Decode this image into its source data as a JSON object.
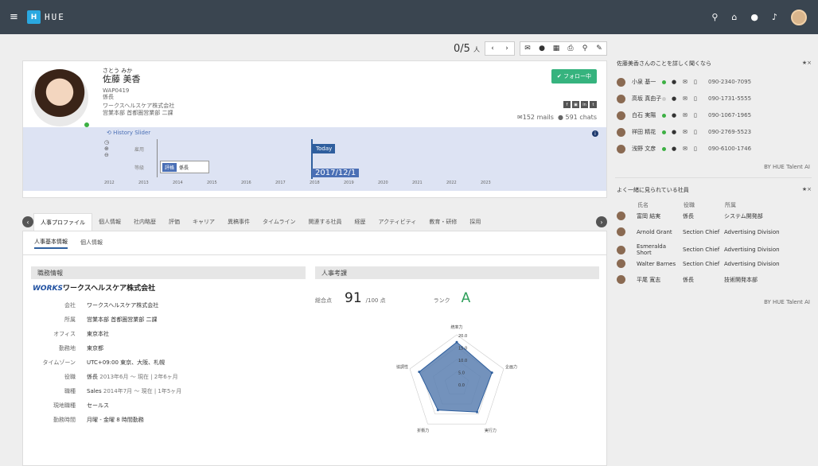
{
  "app": {
    "logo": "HUE"
  },
  "toolbar": {
    "pager": "0/5",
    "pager_unit": "人"
  },
  "profile": {
    "kana": "さとう みか",
    "name": "佐藤 美香",
    "id": "WAP0419",
    "role": "係長",
    "company": "ワークスヘルスケア株式会社",
    "dept": "営業本部 首都圏営業部 二課",
    "follow_label": "フォロー中",
    "mails": "152 mails",
    "chats": "591 chats"
  },
  "history": {
    "title": "History Slider",
    "row1_label": "雇用",
    "row2_label": "等級",
    "today": "Today",
    "grade_tag": "評格",
    "grade_value": "係長",
    "date": "2017/12/1",
    "years": [
      "2012",
      "2013",
      "2014",
      "2015",
      "2016",
      "2017",
      "2018",
      "2019",
      "2020",
      "2021",
      "2022",
      "2023"
    ]
  },
  "tabs": [
    "人事プロファイル",
    "個人情報",
    "社内略歴",
    "評価",
    "キャリア",
    "異稿事件",
    "タイムライン",
    "関連する社員",
    "経歴",
    "アクティビティ",
    "教育・研修",
    "採用"
  ],
  "subtabs": [
    "人事基本情報",
    "個人情報"
  ],
  "job": {
    "header": "職務情報",
    "logo_a": "WORKS",
    "logo_b": "ワークスヘルスケア株式会社",
    "fields": [
      {
        "label": "会社",
        "value": "ワークスヘルスケア株式会社",
        "extra": ""
      },
      {
        "label": "所属",
        "value": "営業本部 首都圏営業部 二課",
        "extra": ""
      },
      {
        "label": "オフィス",
        "value": "東京本社",
        "extra": ""
      },
      {
        "label": "勤務地",
        "value": "東京都",
        "extra": ""
      },
      {
        "label": "タイムゾーン",
        "value": "UTC+09:00 東京、大阪、札幌",
        "extra": ""
      },
      {
        "label": "役職",
        "value": "係長",
        "extra": "2013年6月 ～ 現在 | 2年6ヶ月"
      },
      {
        "label": "職種",
        "value": "Sales",
        "extra": "2014年7月 ～ 現在 | 1年5ヶ月"
      },
      {
        "label": "現地職種",
        "value": "セールス",
        "extra": ""
      },
      {
        "label": "勤務時間",
        "value": "月曜 - 金曜 8 時間勤務",
        "extra": ""
      }
    ]
  },
  "eval": {
    "header": "人事考課",
    "total_label": "総合点",
    "score": "91",
    "score_unit": "/100 点",
    "rank_label": "ランク",
    "rank": "A"
  },
  "chart_data": {
    "type": "radar",
    "categories": [
      "統率力",
      "企画力",
      "実行力",
      "折衝力",
      "協調性"
    ],
    "values": [
      17,
      15,
      14,
      13,
      16
    ],
    "ylim": [
      0,
      20
    ],
    "tick_labels": [
      "20.0",
      "15.0",
      "10.0",
      "5.0",
      "0.0"
    ]
  },
  "side1": {
    "title": "佐藤美香さんのことを詳しく聞くなら",
    "star": "★×",
    "people": [
      {
        "name": "小泉 基一",
        "phone": "090-2340-7095",
        "online": true
      },
      {
        "name": "高坂 真由子",
        "phone": "090-1731-5555",
        "online": false
      },
      {
        "name": "白石 実陽",
        "phone": "090-1067-1965",
        "online": true
      },
      {
        "name": "祥田 精花",
        "phone": "090-2769-5523",
        "online": true
      },
      {
        "name": "浅野 文彦",
        "phone": "090-6100-1746",
        "online": true
      }
    ],
    "by": "BY HUE Talent AI"
  },
  "side2": {
    "title": "よく一緒に見られている社員",
    "star": "★×",
    "cols": [
      "氏名",
      "役職",
      "所属"
    ],
    "people": [
      {
        "name": "富岡 結実",
        "title": "係長",
        "dept": "システム開発部"
      },
      {
        "name": "Arnold Grant",
        "title": "Section Chief",
        "dept": "Advertising Division"
      },
      {
        "name": "Esmeralda Short",
        "title": "Section Chief",
        "dept": "Advertising Division"
      },
      {
        "name": "Walter Barnes",
        "title": "Section Chief",
        "dept": "Advertising Division"
      },
      {
        "name": "平尾 寛志",
        "title": "係長",
        "dept": "技術開発本部"
      }
    ],
    "by": "BY HUE Talent AI"
  }
}
